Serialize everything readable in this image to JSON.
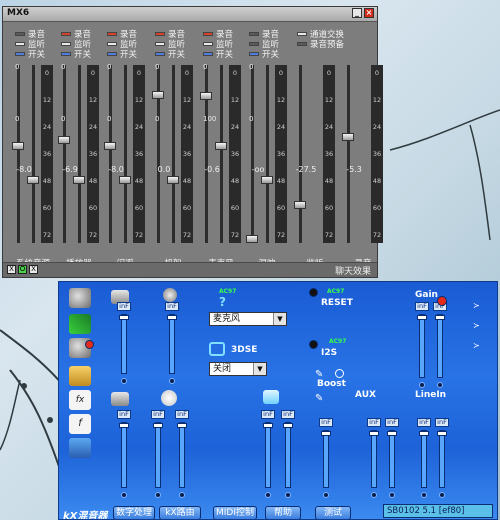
{
  "mixer": {
    "title": "MX6",
    "legend": {
      "record": "录音",
      "monitor": "监听",
      "switch": "开关"
    },
    "legend_right": {
      "swap": "通道交换",
      "rec_monitor": "录音预备"
    },
    "meter_ticks": [
      "0",
      "12",
      "24",
      "36",
      "48",
      "60",
      "72"
    ],
    "channels": [
      {
        "name": "系统音源",
        "value": "-8.0",
        "top": "0",
        "mid": "0",
        "left_level": 0.55,
        "right_level": 0.35
      },
      {
        "name": "播放器",
        "value": "-6.9",
        "top": "0",
        "mid": "0",
        "left_level": 0.58,
        "right_level": 0.35
      },
      {
        "name": "闪避",
        "value": "-8.0",
        "top": "0",
        "mid": "0",
        "left_level": 0.55,
        "right_level": 0.35
      },
      {
        "name": "机架",
        "value": "0.0",
        "top": "0",
        "mid": "0",
        "left_level": 0.85,
        "right_level": 0.35
      },
      {
        "name": "麦克风",
        "value": "-0.6",
        "top": "0",
        "mid": "100",
        "left_level": 0.84,
        "right_level": 0.55
      },
      {
        "name": "混响",
        "value": "-oo",
        "top": "0",
        "mid": "0",
        "left_level": 0.0,
        "right_level": 0.35
      },
      {
        "name": "监听",
        "value": "-27.5",
        "top": "",
        "mid": "",
        "left_level": 0.2,
        "right_level": null
      },
      {
        "name": "录音",
        "value": "-5.3",
        "top": "",
        "mid": "",
        "left_level": 0.6,
        "right_level": null
      }
    ],
    "footer_label": "聊天效果",
    "footer_buttons": [
      "X",
      "O",
      "X"
    ]
  },
  "kx": {
    "select_mic": "麦克风",
    "select_off": "关闭",
    "label_3dse": "3DSE",
    "label_reset": "RESET",
    "label_i2s": "I2S",
    "label_boost": "Boost",
    "label_aux": "AUX",
    "label_linein": "LineIn",
    "label_gain": "Gain",
    "green_tag": "AC97",
    "inf": "inF",
    "buttons": [
      "数字处理",
      "kX路由",
      "MIDI控制",
      "帮助",
      "测试"
    ],
    "logo_text": "kX混音器",
    "status": "SB0102 5.1 [ef80]"
  },
  "colors": {
    "mixer_bg": "#7d7d7d",
    "kx_blue": "#2873e6",
    "record_red": "#d9442f",
    "switch_blue": "#4f7de0",
    "slider_fill": "#58a6ff"
  }
}
